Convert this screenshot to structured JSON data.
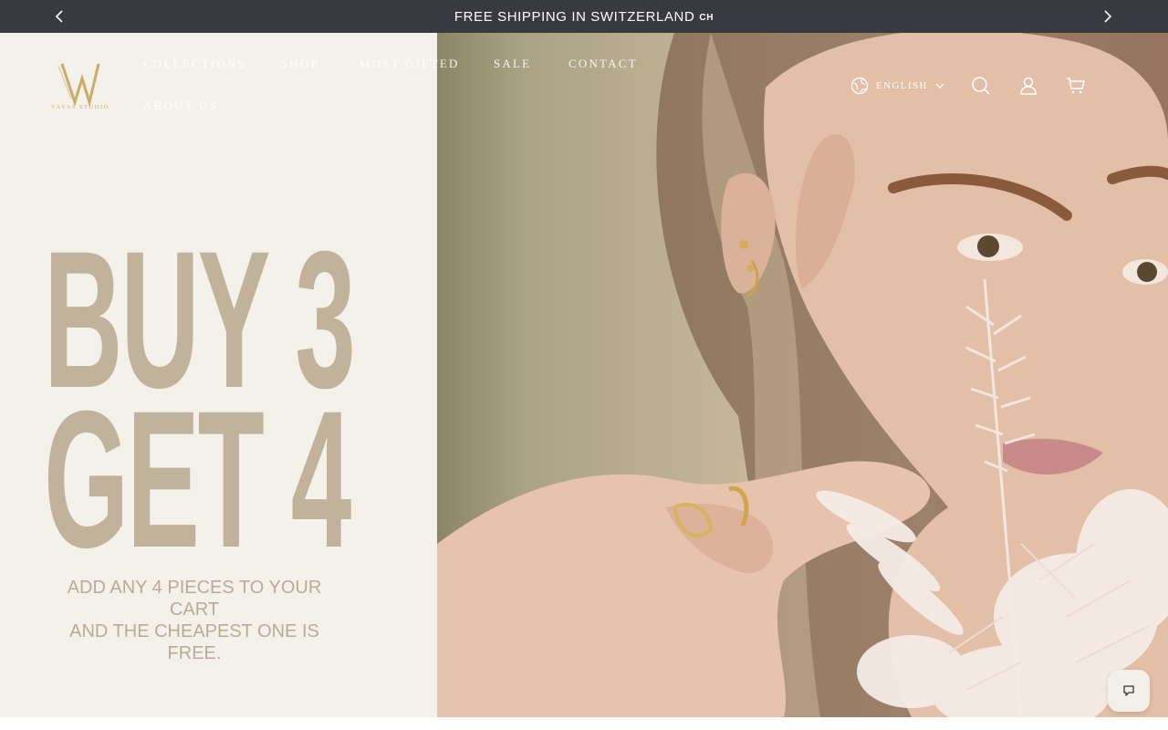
{
  "announcement": {
    "text": "FREE SHIPPING IN SWITZERLAND",
    "country_code": "CH",
    "prev_icon": "chevron-left-icon",
    "next_icon": "chevron-right-icon",
    "bg_color": "#393942"
  },
  "header": {
    "logo_alt": "Vayas Studio",
    "nav": [
      "COLLECTIONS",
      "SHOP",
      "MOST GIFTED",
      "SALE",
      "CONTACT",
      "ABOUT US"
    ],
    "language": "ENGLISH",
    "icons": [
      "globe-icon",
      "search-icon",
      "account-icon",
      "cart-icon"
    ]
  },
  "hero": {
    "headline_line1": "BUY 3",
    "headline_line2": "GET 4",
    "subline1": "ADD ANY 4 PIECES TO YOUR CART",
    "subline2": "AND THE CHEAPEST ONE IS FREE.",
    "accent_color": "#c1b29b",
    "panel_color": "#f4f1eb"
  },
  "chat": {
    "icon": "chat-icon"
  }
}
